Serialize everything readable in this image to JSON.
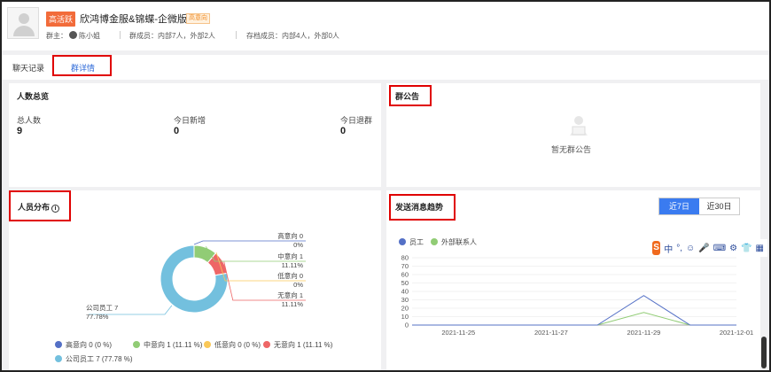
{
  "header": {
    "tag_hot": "高活跃",
    "group_name": "欣鸿博金服&锦蝶-企微版",
    "tag_intent": "高意向",
    "owner_label": "群主：",
    "owner_name": "陈小姐",
    "members": "群成员：内部7人，外部2人",
    "archived": "存档成员：内部4人，外部0人"
  },
  "tabs": [
    {
      "label": "聊天记录"
    },
    {
      "label": "群详情"
    }
  ],
  "overview": {
    "title": "人数总览",
    "stats": [
      {
        "label": "总人数",
        "value": "9"
      },
      {
        "label": "今日新增",
        "value": "0"
      },
      {
        "label": "今日退群",
        "value": "0"
      }
    ]
  },
  "notice": {
    "title": "群公告",
    "empty_text": "暂无群公告"
  },
  "distribution": {
    "title": "人员分布",
    "info_icon": "i",
    "colors": [
      "#5470c6",
      "#91cc75",
      "#fac858",
      "#ee6666",
      "#73c0de"
    ],
    "labels": [
      {
        "line1": "高意向 0",
        "line2": "0%"
      },
      {
        "line1": "中意向 1",
        "line2": "11.11%"
      },
      {
        "line1": "低意向 0",
        "line2": "0%"
      },
      {
        "line1": "无意向 1",
        "line2": "11.11%"
      },
      {
        "line1": "公司员工 7",
        "line2": "77.78%"
      }
    ],
    "legend": [
      "高意向 0 (0 %)",
      "中意向 1 (11.11 %)",
      "低意向 0 (0 %)",
      "无意向 1 (11.11 %)",
      "公司员工 7 (77.78 %)"
    ]
  },
  "trend": {
    "title": "发送消息趋势",
    "range_buttons": [
      {
        "label": "近7日",
        "active": true
      },
      {
        "label": "近30日",
        "active": false
      }
    ],
    "legend": [
      {
        "name": "员工",
        "color": "#5470c6"
      },
      {
        "name": "外部联系人",
        "color": "#91cc75"
      }
    ]
  },
  "chart_data": [
    {
      "type": "pie",
      "title": "",
      "categories": [
        "高意向",
        "中意向",
        "低意向",
        "无意向",
        "公司员工"
      ],
      "values": [
        0,
        1,
        0,
        1,
        7
      ],
      "percent": [
        0,
        11.11,
        0,
        11.11,
        77.78
      ]
    },
    {
      "type": "line",
      "title": "",
      "x": [
        "2021-11-24",
        "2021-11-25",
        "2021-11-26",
        "2021-11-27",
        "2021-11-28",
        "2021-11-29",
        "2021-11-30",
        "2021-12-01"
      ],
      "x_tick_labels": [
        "2021-11-25",
        "2021-11-27",
        "2021-11-29",
        "2021-12-01"
      ],
      "series": [
        {
          "name": "员工",
          "values": [
            0,
            0,
            0,
            0,
            0,
            35,
            0,
            0
          ]
        },
        {
          "name": "外部联系人",
          "values": [
            0,
            0,
            0,
            0,
            0,
            15,
            0,
            0
          ]
        }
      ],
      "ylim": [
        0,
        80
      ],
      "yticks": [
        0,
        10,
        20,
        30,
        40,
        50,
        60,
        70,
        80
      ]
    }
  ],
  "ime": {
    "logo": "S",
    "items": [
      "中",
      "°,",
      "☺",
      "🎤",
      "⌨",
      "⚙",
      "👕",
      "▦"
    ]
  }
}
